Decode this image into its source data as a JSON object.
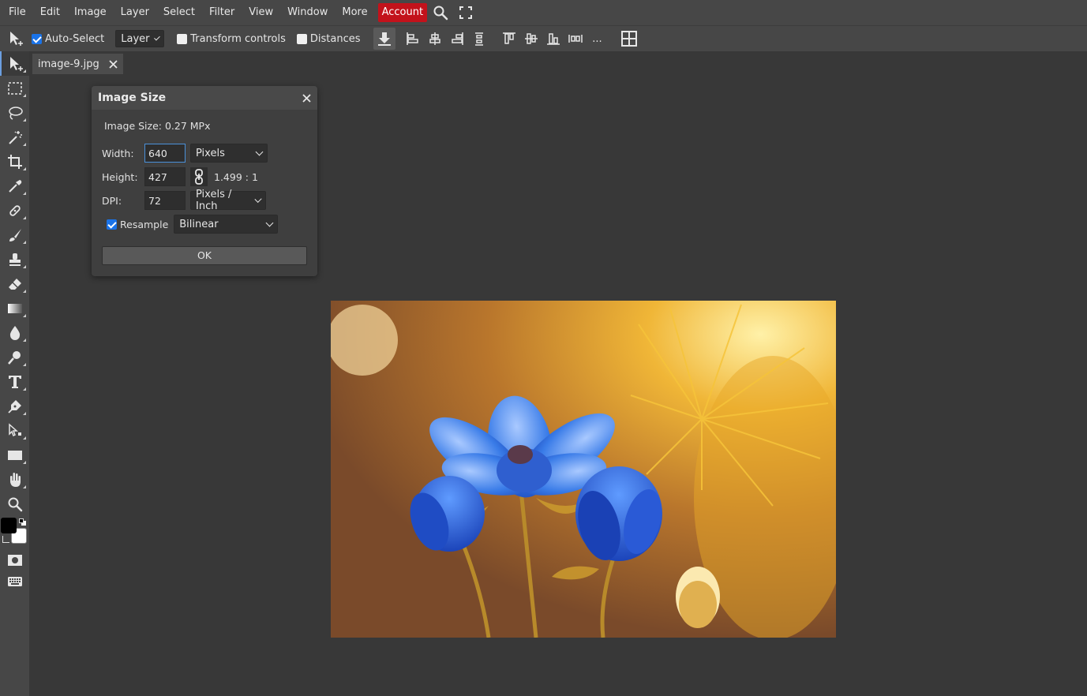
{
  "menubar": {
    "items": [
      "File",
      "Edit",
      "Image",
      "Layer",
      "Select",
      "Filter",
      "View",
      "Window",
      "More"
    ],
    "account": "Account",
    "icons": [
      "search-icon",
      "fullscreen-icon"
    ]
  },
  "options": {
    "auto_select_label": "Auto-Select",
    "auto_select_checked": true,
    "target_select": "Layer",
    "transform_controls_label": "Transform controls",
    "transform_controls_checked": false,
    "distances_label": "Distances",
    "distances_checked": false,
    "more": "..."
  },
  "tab": {
    "filename": "image-9.jpg"
  },
  "dialog": {
    "title": "Image Size",
    "info": "Image Size: 0.27 MPx",
    "width_label": "Width:",
    "width_value": "640",
    "width_unit": "Pixels",
    "height_label": "Height:",
    "height_value": "427",
    "ratio": "1.499 : 1",
    "dpi_label": "DPI:",
    "dpi_value": "72",
    "dpi_unit": "Pixels / Inch",
    "resample_label": "Resample",
    "resample_checked": true,
    "resample_method": "Bilinear",
    "ok_label": "OK"
  },
  "colors": {
    "accent": "#1a73e8",
    "account_bg": "#c3121b",
    "foreground_color": "#000000",
    "background_color": "#ffffff"
  }
}
